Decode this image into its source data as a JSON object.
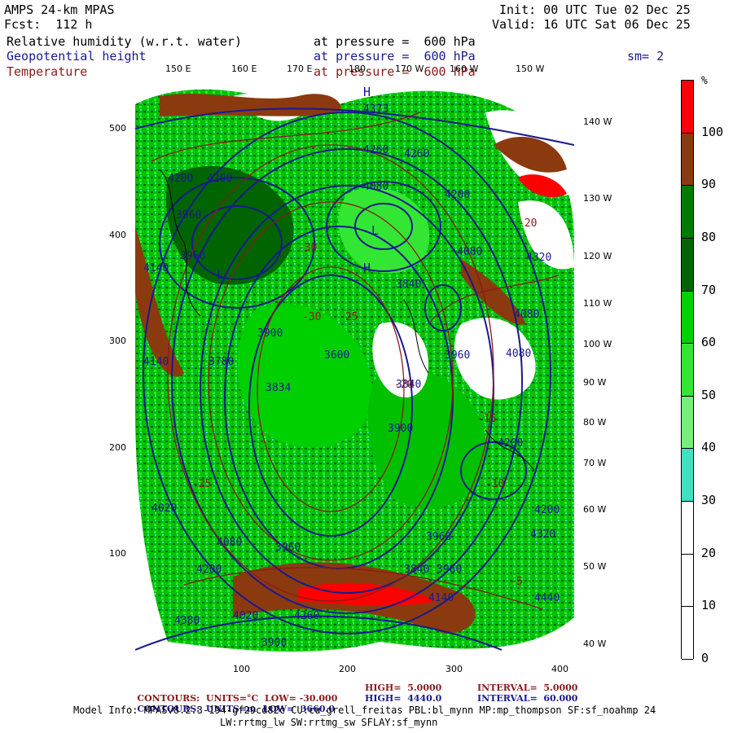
{
  "header": {
    "model": "AMPS 24-km MPAS",
    "fcst": "Fcst:  112 h",
    "init": "Init: 00 UTC Tue 02 Dec 25",
    "valid": "Valid: 16 UTC Sat 06 Dec 25",
    "sm": "sm= 2"
  },
  "fields": [
    {
      "name": "Relative humidity (w.r.t. water)",
      "level": "at pressure =  600 hPa",
      "color": "#000000"
    },
    {
      "name": "Geopotential height",
      "level": "at pressure =  600 hPa",
      "color": "#1a1a8c"
    },
    {
      "name": "Temperature",
      "level": "at pressure =  600 hPa",
      "color": "#8b1a1a"
    }
  ],
  "colorbar": {
    "unit": "%",
    "ticks": [
      "100",
      "90",
      "80",
      "70",
      "60",
      "50",
      "40",
      "30",
      "20",
      "10",
      "0"
    ],
    "bands": [
      {
        "from": 100,
        "to": 110,
        "color": "#ff0000"
      },
      {
        "from": 90,
        "to": 100,
        "color": "#8b3a0f"
      },
      {
        "from": 80,
        "to": 90,
        "color": "#007a00"
      },
      {
        "from": 70,
        "to": 80,
        "color": "#006400"
      },
      {
        "from": 60,
        "to": 70,
        "color": "#00d000"
      },
      {
        "from": 50,
        "to": 60,
        "color": "#33e633"
      },
      {
        "from": 40,
        "to": 50,
        "color": "#77ee77"
      },
      {
        "from": 30,
        "to": 40,
        "color": "#40e0c0"
      },
      {
        "from": 20,
        "to": 30,
        "color": "#ffffff"
      },
      {
        "from": 10,
        "to": 20,
        "color": "#ffffff"
      },
      {
        "from": 0,
        "to": 10,
        "color": "#ffffff"
      }
    ]
  },
  "axes": {
    "x_ticks": [
      "100",
      "200",
      "300",
      "400"
    ],
    "y_ticks": [
      "500",
      "400",
      "300",
      "200",
      "100"
    ],
    "top_lon": [
      "150 E",
      "160 E",
      "170 E",
      "180",
      "170 W",
      "160 W",
      "150 W"
    ],
    "right_lon": [
      "140 W",
      "130 W",
      "120 W",
      "110 W",
      "100 W",
      "90 W",
      "80 W",
      "70 W",
      "60 W",
      "50 W",
      "40 W"
    ]
  },
  "map_labels": {
    "heights": [
      "4373",
      "4260",
      "4200",
      "4200",
      "4080",
      "4260",
      "4200",
      "3960",
      "3960",
      "4140",
      "4080",
      "4320",
      "3840",
      "4080",
      "3900",
      "4140",
      "3780",
      "3834",
      "3600",
      "3960",
      "3840",
      "4080",
      "3900",
      "4200",
      "4020",
      "4080",
      "4320",
      "4200",
      "4200",
      "3960",
      "4380",
      "4020",
      "4260",
      "4140",
      "3960",
      "4440",
      "3960",
      "3840",
      "3900"
    ],
    "temps": [
      "-30",
      "-25",
      "-20",
      "-15",
      "-10",
      "-5",
      "-30",
      "-25",
      "-20"
    ],
    "highs": [
      "H",
      "H",
      "L",
      "L"
    ]
  },
  "footer": {
    "temp_contours": {
      "label": "CONTOURS:",
      "units": "UNITS=°C",
      "low": "LOW= -30.000",
      "high": "HIGH=  5.0000",
      "interval": "INTERVAL=  5.0000"
    },
    "height_contours": {
      "label": "CONTOURS:",
      "units": "UNITS=m",
      "low": "LOW=  3660.0",
      "high": "HIGH=  4440.0",
      "interval": "INTERVAL=  60.000"
    },
    "model_info": "Model Info: MPASv8.2.3-194-gf29cd82c CU:cu_grell_freitas PBL:bl_mynn MP:mp_thompson SF:sf_noahmp 24",
    "model_info2": "LW:rrtmg_lw SW:rrtmg_sw SFLAY:sf_mynn"
  }
}
